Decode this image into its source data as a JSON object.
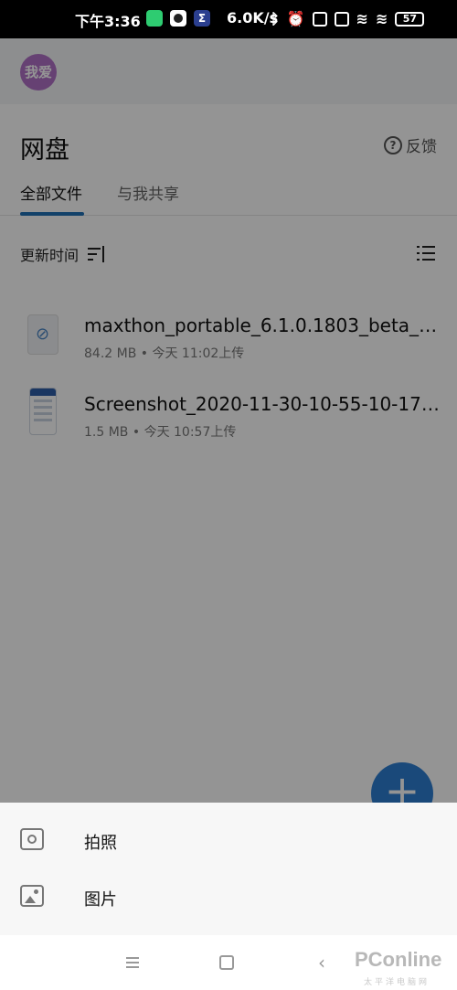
{
  "status_bar": {
    "time": "下午3:36",
    "net_speed": "6.0K/s",
    "battery": "57",
    "icons": [
      "app-notify-icon",
      "circle-app-icon",
      "sigma-icon",
      "bluetooth-icon",
      "alarm-icon",
      "hd-signal-icon",
      "hd-signal-icon",
      "wifi-icon",
      "wifi-icon",
      "battery-icon"
    ]
  },
  "header": {
    "avatar_text": "我爱",
    "title": "网盘",
    "feedback_label": "反馈"
  },
  "tabs": [
    {
      "label": "全部文件",
      "active": true
    },
    {
      "label": "与我共享",
      "active": false
    }
  ],
  "sort": {
    "label": "更新时间"
  },
  "files": [
    {
      "name": "maxthon_portable_6.1.0.1803_beta_x…",
      "size": "84.2 MB",
      "time": "今天 11:02上传",
      "type": "document"
    },
    {
      "name": "Screenshot_2020-11-30-10-55-10-176_…",
      "size": "1.5 MB",
      "time": "今天 10:57上传",
      "type": "image"
    }
  ],
  "fab": {
    "label": "+"
  },
  "sheet": {
    "items": [
      {
        "label": "拍照",
        "icon": "camera-icon"
      },
      {
        "label": "图片",
        "icon": "image-icon"
      }
    ]
  },
  "watermark": {
    "main": "PConline",
    "sub": "太平洋电脑网"
  },
  "colors": {
    "accent": "#1f70b6",
    "fab": "#2d7fd2",
    "avatar": "#b071c7"
  }
}
